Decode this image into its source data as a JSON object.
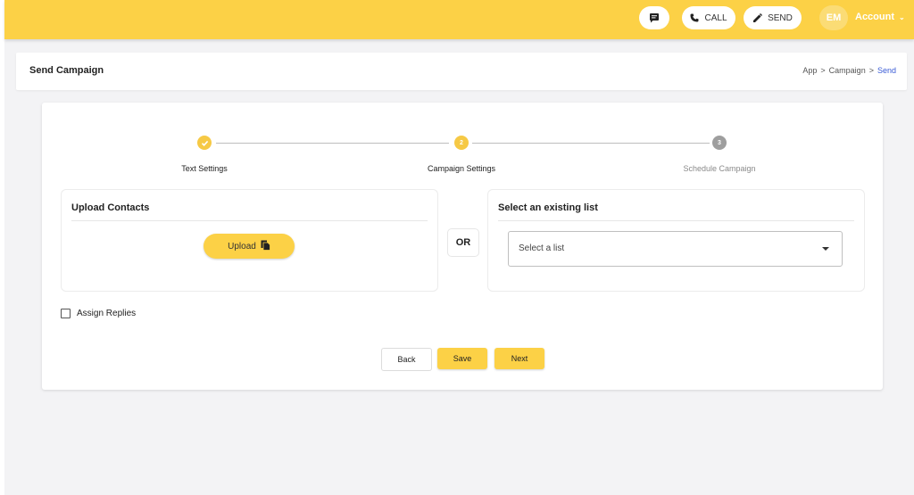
{
  "topbar": {
    "call_label": "CALL",
    "send_label": "SEND",
    "avatar_initials": "EM",
    "account_label": "Account",
    "icons": {
      "messages": "chat-icon",
      "call": "phone-icon",
      "send": "pencil-icon",
      "account_menu": "chevron-down-icon"
    }
  },
  "header": {
    "title": "Send Campaign",
    "breadcrumb": [
      "App",
      "Campaign",
      "Send"
    ],
    "separator": ">"
  },
  "stepper": {
    "steps": [
      {
        "label": "Text Settings",
        "number": "1",
        "state": "completed"
      },
      {
        "label": "Campaign Settings",
        "number": "2",
        "state": "active"
      },
      {
        "label": "Schedule Campaign",
        "number": "3",
        "state": "pending"
      }
    ]
  },
  "upload_panel": {
    "title": "Upload Contacts",
    "button_label": "Upload",
    "icon": "file-copy-icon"
  },
  "or_label": "OR",
  "list_panel": {
    "title": "Select an existing list",
    "select_value": "Select a list"
  },
  "assign_replies": {
    "label": "Assign Replies",
    "checked": false
  },
  "actions": {
    "back": "Back",
    "save": "Save",
    "next": "Next"
  },
  "colors": {
    "accent": "#fcd146",
    "active_step": "#f6c945",
    "pending_step": "#9e9e9e",
    "link": "#3a5cd6",
    "background": "#f3f3f5"
  }
}
